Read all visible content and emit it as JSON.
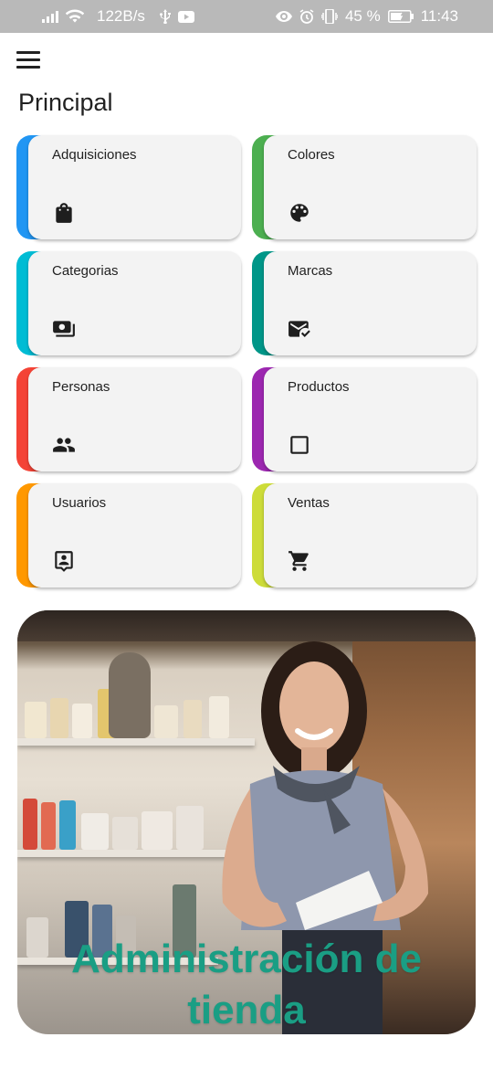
{
  "status_bar": {
    "speed": "122B/s",
    "battery_level": "45 %",
    "time": "11:43",
    "icons": [
      "signal-icon",
      "wifi-icon",
      "usb-icon",
      "youtube-icon",
      "eye-icon",
      "alarm-icon",
      "vibrate-icon",
      "battery-icon"
    ]
  },
  "app_bar": {
    "menu_icon": "menu-icon"
  },
  "page": {
    "title": "Principal"
  },
  "cards": [
    {
      "label": "Adquisiciones",
      "icon": "shopping-bag-icon",
      "accent": "#2196f3"
    },
    {
      "label": "Colores",
      "icon": "palette-icon",
      "accent": "#4caf50"
    },
    {
      "label": "Categorias",
      "icon": "local-atm-icon",
      "accent": "#00bcd4"
    },
    {
      "label": "Marcas",
      "icon": "mark-email-read-icon",
      "accent": "#009688"
    },
    {
      "label": "Personas",
      "icon": "people-icon",
      "accent": "#f44336"
    },
    {
      "label": "Productos",
      "icon": "check-box-outline-icon",
      "accent": "#9c27b0"
    },
    {
      "label": "Usuarios",
      "icon": "contact-page-icon",
      "accent": "#ff9800"
    },
    {
      "label": "Ventas",
      "icon": "shopping-cart-icon",
      "accent": "#cddc39"
    }
  ],
  "banner": {
    "title_line1": "Administración de",
    "title_line2": "tienda",
    "title_color": "#1a9e84"
  }
}
